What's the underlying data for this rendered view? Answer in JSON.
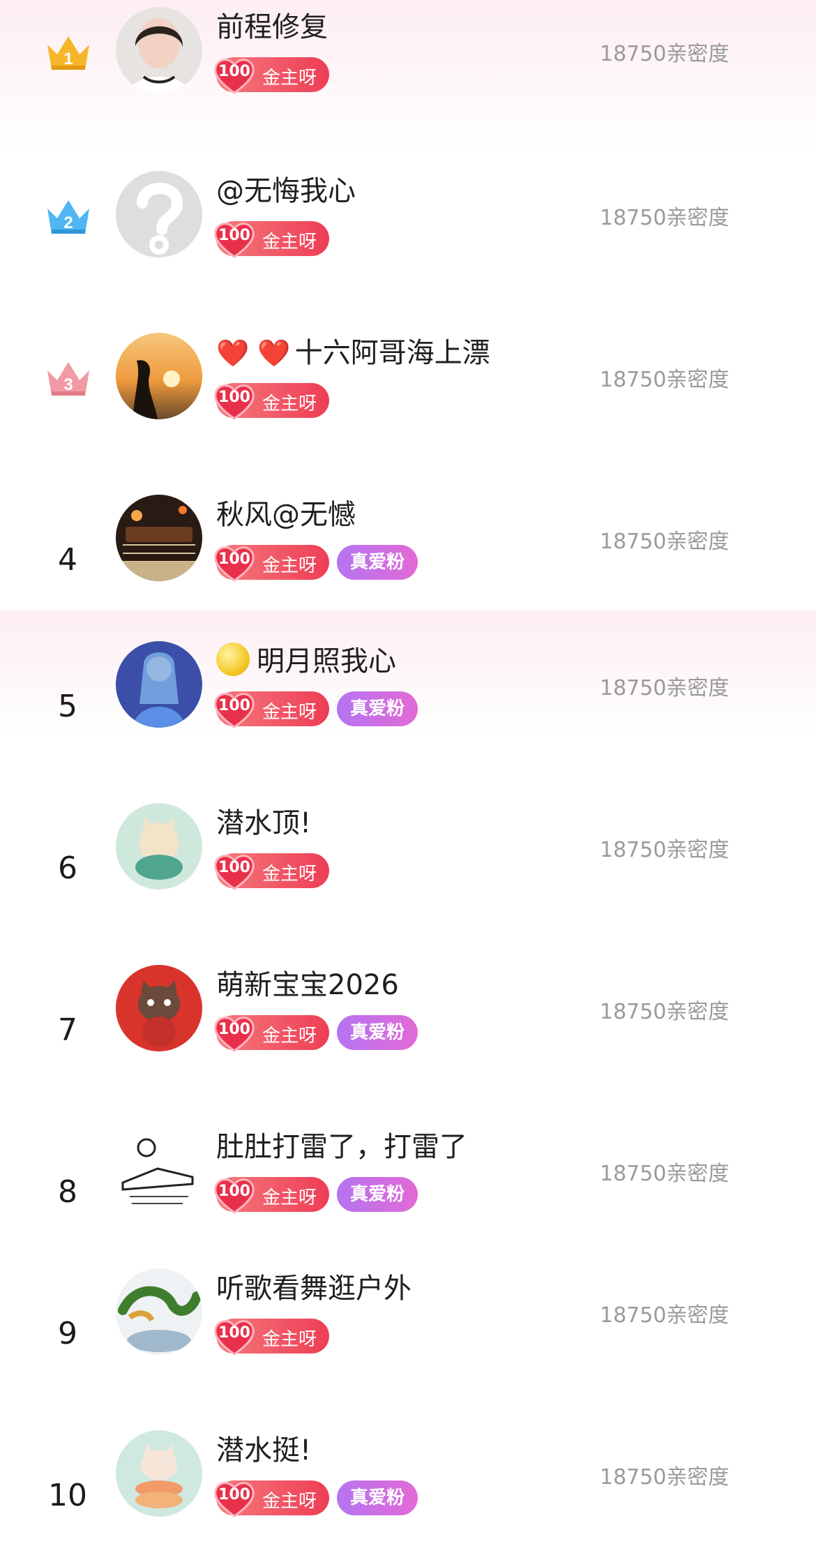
{
  "ranking": {
    "score_suffix": "亲密度",
    "rows": [
      {
        "rank": "1",
        "name": "前程修复",
        "level": "100",
        "badge": "金主呀",
        "fan_badge": "",
        "score": "18750亲密度"
      },
      {
        "rank": "2",
        "name": "@无悔我心",
        "level": "100",
        "badge": "金主呀",
        "fan_badge": "",
        "score": "18750亲密度"
      },
      {
        "rank": "3",
        "name": "十六阿哥海上漂",
        "name_prefix": "❤️ ❤️",
        "level": "100",
        "badge": "金主呀",
        "fan_badge": "",
        "score": "18750亲密度"
      },
      {
        "rank": "4",
        "name": "秋风@无憾",
        "level": "100",
        "badge": "金主呀",
        "fan_badge": "真爱粉",
        "score": "18750亲密度"
      },
      {
        "rank": "5",
        "name": "明月照我心",
        "level": "100",
        "badge": "金主呀",
        "fan_badge": "真爱粉",
        "score": "18750亲密度"
      },
      {
        "rank": "6",
        "name": "潜水顶!",
        "level": "100",
        "badge": "金主呀",
        "fan_badge": "",
        "score": "18750亲密度"
      },
      {
        "rank": "7",
        "name": "萌新宝宝2026",
        "level": "100",
        "badge": "金主呀",
        "fan_badge": "真爱粉",
        "score": "18750亲密度"
      },
      {
        "rank": "8",
        "name": "肚肚打雷了，打雷了",
        "level": "100",
        "badge": "金主呀",
        "fan_badge": "真爱粉",
        "score": "18750亲密度"
      },
      {
        "rank": "9",
        "name": "听歌看舞逛户外",
        "level": "100",
        "badge": "金主呀",
        "fan_badge": "",
        "score": "18750亲密度"
      },
      {
        "rank": "10",
        "name": "潜水挺!",
        "level": "100",
        "badge": "金主呀",
        "fan_badge": "真爱粉",
        "score": "18750亲密度"
      }
    ]
  },
  "colors": {
    "crown_gold": "#f6b62a",
    "crown_blue": "#4fb6f3",
    "crown_pink": "#f19aa4",
    "badge_red": "#ee3d55",
    "badge_purple": "#c06ee6",
    "score_gray": "#9a9a9a"
  }
}
